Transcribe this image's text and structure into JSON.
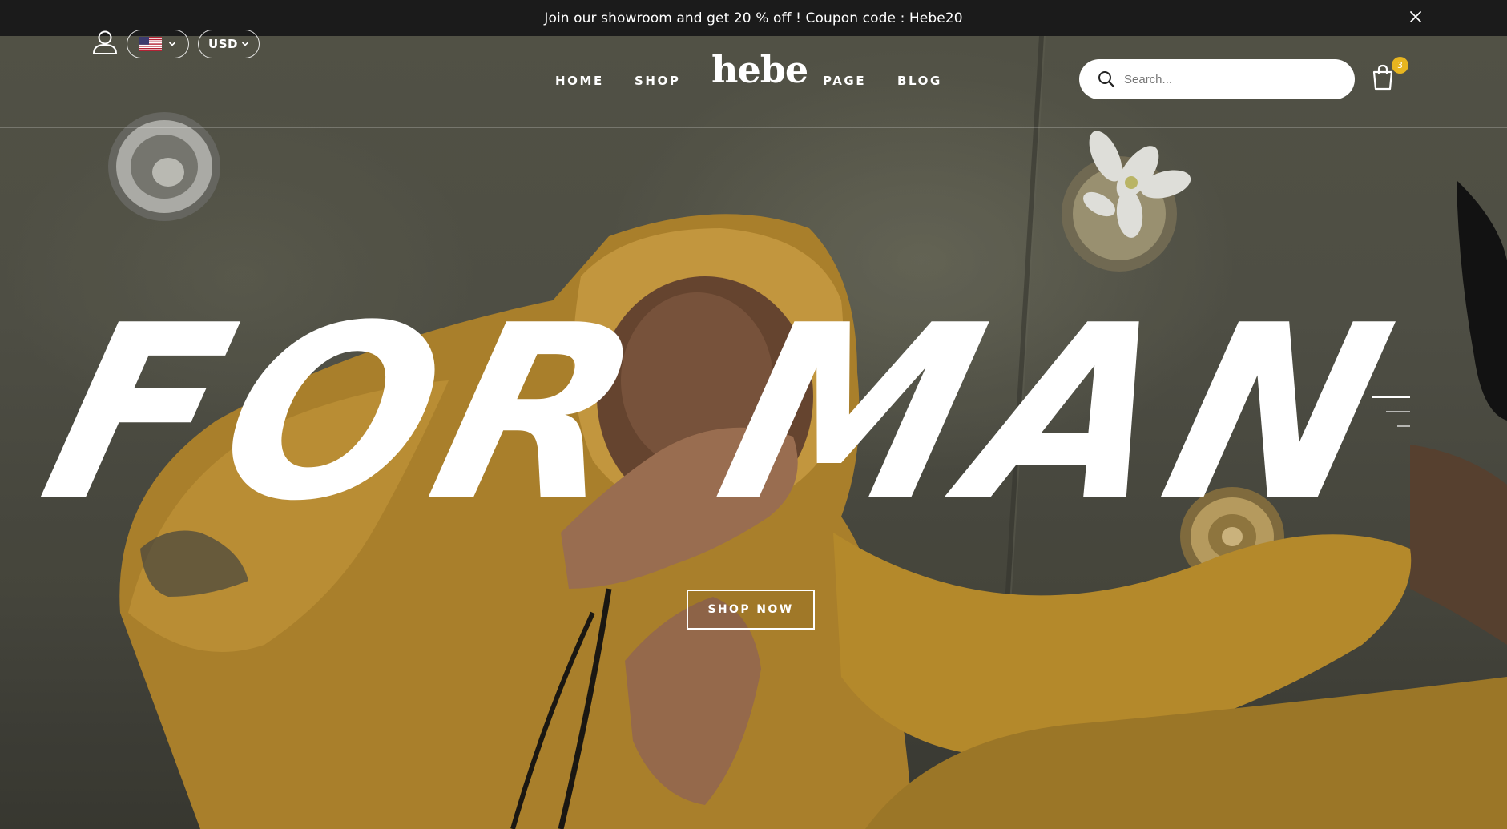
{
  "announcement": {
    "text": "Join our showroom and get 20 % off ! Coupon code : Hebe20",
    "close_icon": "close-icon"
  },
  "header": {
    "account_icon": "user-icon",
    "language": {
      "selected": "English (US)",
      "flag_icon": "us-flag-icon"
    },
    "currency": {
      "selected": "USD"
    },
    "nav": {
      "home": "HOME",
      "shop": "SHOP",
      "page": "PAGE",
      "blog": "BLOG"
    },
    "logo": "hebe",
    "search": {
      "placeholder": "Search..."
    },
    "cart": {
      "icon": "shopping-bag-icon",
      "count": "3"
    }
  },
  "hero": {
    "headline": "FOR MAN",
    "cta_label": "SHOP NOW",
    "slides": {
      "total": 3,
      "active": 1
    }
  },
  "colors": {
    "announcement_bg": "#1b1b1b",
    "badge": "#e7b520",
    "hoodie": "#c49331",
    "background_wall": "#55554a"
  }
}
